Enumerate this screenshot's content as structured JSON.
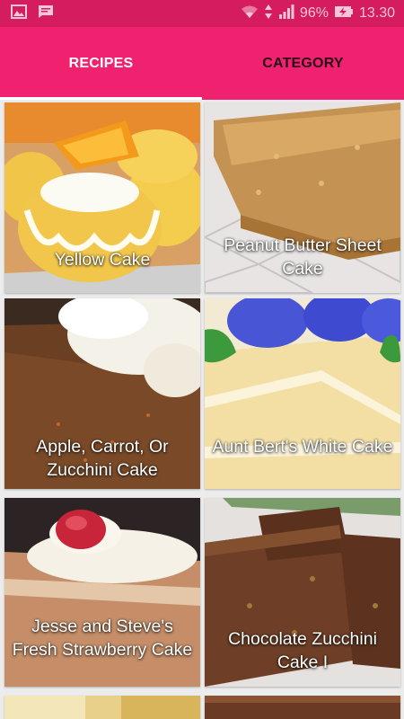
{
  "status_bar": {
    "battery": "96%",
    "time": "13.30",
    "icons": [
      "image-icon",
      "message-icon",
      "wifi-icon",
      "data-arrows-icon",
      "signal-icon",
      "battery-charging-icon"
    ]
  },
  "tabs": [
    {
      "label": "RECIPES",
      "selected": true
    },
    {
      "label": "CATEGORY",
      "selected": false
    }
  ],
  "recipes": [
    {
      "title": "Yellow Cake"
    },
    {
      "title": "Peanut Butter Sheet Cake"
    },
    {
      "title": "Apple, Carrot, Or Zucchini Cake"
    },
    {
      "title": "Aunt Bert's White Cake"
    },
    {
      "title": "Jesse and Steve's Fresh Strawberry Cake"
    },
    {
      "title": "Chocolate Zucchini Cake I"
    }
  ],
  "colors": {
    "primary": "#f0216f",
    "status_bar": "#d41c5e"
  }
}
